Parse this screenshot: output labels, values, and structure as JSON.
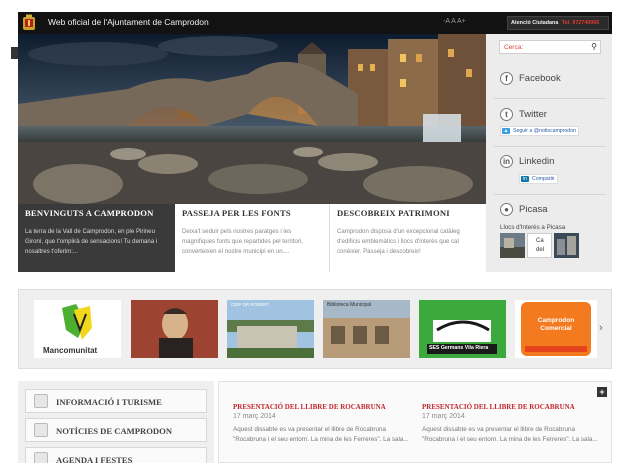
{
  "header": {
    "site_title": "Web oficial de l'Ajuntament de Camprodon",
    "font_size_control": "-A A A+",
    "citizen_label": "Atenció Ciutadana",
    "citizen_phone": "Tel. 972740005"
  },
  "hero": {
    "image": "camprodon-bridge-photo"
  },
  "features": [
    {
      "title": "Benvinguts a Camprodon",
      "text": "La terra de la Vall de Camprodon, en ple Pirineu Gironí, que t'omplirà de sensacions! Tu demana i nosaltres t'oferim:..."
    },
    {
      "title": "Passeja per les fonts",
      "text": "Deixa't seduir pels nostres paratges i les magnífiques fonts que repartides pel territori, converteixen el nostre municipi en un...."
    },
    {
      "title": "Descobreix patrimoni",
      "text": "Camprodon disposa d'un excepcional catàleg d'edificis emblemàtics i llocs d'interès que cal conèixer. Passeja i descobreix!"
    }
  ],
  "sidebar": {
    "search_placeholder": "Cerca:",
    "facebook_label": "Facebook",
    "twitter_label": "Twitter",
    "twitter_follow": "Seguir a @notiscamprodon",
    "linkedin_label": "Linkedin",
    "linkedin_share": "Compartir",
    "picasa_label": "Picasa",
    "interest_label": "Llocs d'Interès a Picasa",
    "thumb_caption": "Ca del"
  },
  "carousel": {
    "items": [
      {
        "label": "Mancomunitat",
        "icon": "mancomunitat-logo"
      },
      {
        "label": "",
        "icon": "portrait-photo"
      },
      {
        "label": "CEIP DR ROBERT",
        "icon": "school-photo"
      },
      {
        "label": "Biblioteca Municipal",
        "icon": "library-photo"
      },
      {
        "label": "SES Germans Vila Riera",
        "icon": "ses-logo"
      },
      {
        "label": "Camprodon Comercial",
        "icon": "commerce-logo"
      }
    ],
    "next_arrow": "›"
  },
  "menu": {
    "items": [
      {
        "label": "Informació i turisme",
        "icon": "info-icon"
      },
      {
        "label": "Notícies de Camprodon",
        "icon": "news-icon"
      },
      {
        "label": "Agenda i festes",
        "icon": "calendar-icon"
      }
    ]
  },
  "news": {
    "plus": "+",
    "items": [
      {
        "title": "Presentació del llibre de Rocabruna",
        "date": "17 març 2014",
        "text": "Aquest dissabte es va presentar el llibre de Rocabruna \"Rocabruna i el seu entorn. La mina de les Ferreres\". La sala..."
      },
      {
        "title": "Presentació del llibre de Rocabruna",
        "date": "17 març 2014",
        "text": "Aquest dissabte es va presentar el llibre de Rocabruna \"Rocabruna i el seu entorn. La mina de les Ferreres\". La sala..."
      }
    ]
  },
  "colors": {
    "accent_red": "#c0272d",
    "topbar": "#121212",
    "sidebar_bg": "#ececec"
  }
}
